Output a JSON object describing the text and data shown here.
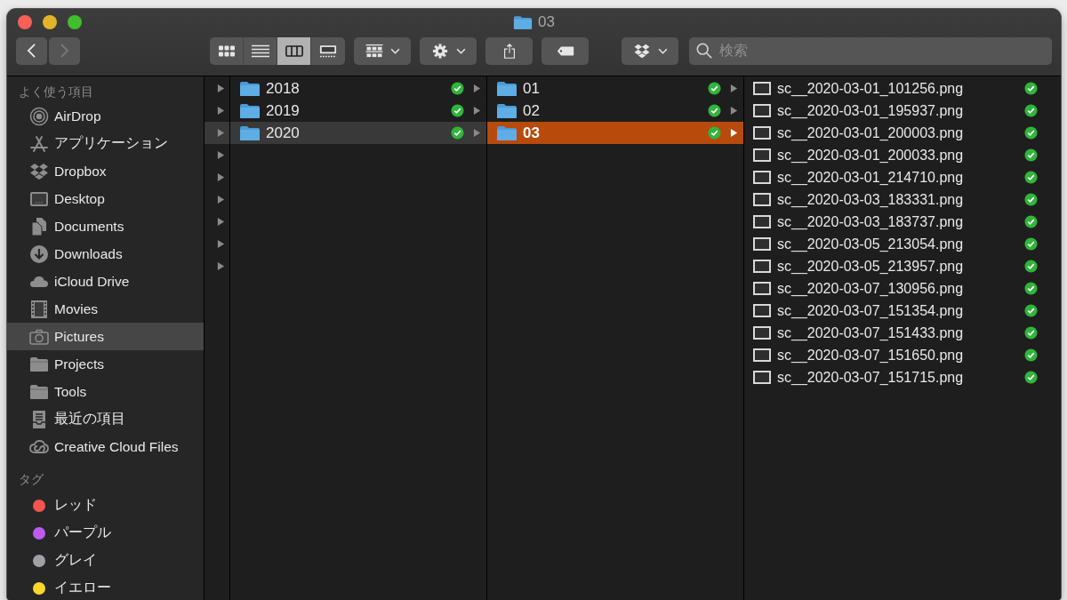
{
  "window": {
    "title": "03"
  },
  "toolbar": {
    "nav": [
      {
        "kind": "back",
        "disabled": false
      },
      {
        "kind": "forward",
        "disabled": true
      }
    ],
    "view_modes": [
      {
        "kind": "icons",
        "selected": false
      },
      {
        "kind": "list",
        "selected": false
      },
      {
        "kind": "columns",
        "selected": true
      },
      {
        "kind": "gallery",
        "selected": false
      }
    ],
    "buttons": [
      {
        "kind": "group",
        "menu": true
      },
      {
        "kind": "action",
        "menu": true
      },
      {
        "kind": "share",
        "menu": false
      },
      {
        "kind": "tag",
        "menu": false
      },
      {
        "kind": "dropbox",
        "menu": true
      }
    ],
    "search": {
      "placeholder": "検索"
    }
  },
  "sidebar": {
    "sections": [
      {
        "heading": "よく使う項目",
        "items": [
          {
            "kind": "airdrop",
            "label": "AirDrop",
            "selected": false
          },
          {
            "kind": "apps",
            "label": "アプリケーション",
            "selected": false
          },
          {
            "kind": "dropbox",
            "label": "Dropbox",
            "selected": false
          },
          {
            "kind": "desktop",
            "label": "Desktop",
            "selected": false
          },
          {
            "kind": "documents",
            "label": "Documents",
            "selected": false
          },
          {
            "kind": "downloads",
            "label": "Downloads",
            "selected": false
          },
          {
            "kind": "cloud",
            "label": "iCloud Drive",
            "selected": false
          },
          {
            "kind": "movies",
            "label": "Movies",
            "selected": false
          },
          {
            "kind": "pictures",
            "label": "Pictures",
            "selected": true
          },
          {
            "kind": "folder",
            "label": "Projects",
            "selected": false
          },
          {
            "kind": "folder",
            "label": "Tools",
            "selected": false
          },
          {
            "kind": "recent",
            "label": "最近の項目",
            "selected": false
          },
          {
            "kind": "creative-cloud",
            "label": "Creative Cloud Files",
            "selected": false
          }
        ]
      },
      {
        "heading": "タグ",
        "items": [
          {
            "kind": "tag",
            "label": "レッド",
            "color": "#f25450",
            "selected": false
          },
          {
            "kind": "tag",
            "label": "パープル",
            "color": "#be5af0",
            "selected": false
          },
          {
            "kind": "tag",
            "label": "グレイ",
            "color": "#a0a0a5",
            "selected": false
          },
          {
            "kind": "tag",
            "label": "イエロー",
            "color": "#fbd62c",
            "selected": false
          }
        ]
      }
    ]
  },
  "columns": [
    {
      "items": [
        {
          "kind": "stub",
          "selected": false,
          "focused": false
        },
        {
          "kind": "stub",
          "selected": false,
          "focused": false
        },
        {
          "kind": "stub",
          "selected": true,
          "focused": false
        },
        {
          "kind": "stub",
          "selected": false,
          "focused": false
        },
        {
          "kind": "stub",
          "selected": false,
          "focused": false
        },
        {
          "kind": "stub",
          "selected": false,
          "focused": false
        },
        {
          "kind": "stub",
          "selected": false,
          "focused": false
        },
        {
          "kind": "stub",
          "selected": false,
          "focused": false
        },
        {
          "kind": "stub",
          "selected": false,
          "focused": false
        }
      ]
    },
    {
      "items": [
        {
          "kind": "folder",
          "name": "2018",
          "synced": true,
          "selected": false,
          "focused": false
        },
        {
          "kind": "folder",
          "name": "2019",
          "synced": true,
          "selected": false,
          "focused": false
        },
        {
          "kind": "folder",
          "name": "2020",
          "synced": true,
          "selected": true,
          "focused": false
        }
      ]
    },
    {
      "items": [
        {
          "kind": "folder",
          "name": "01",
          "synced": true,
          "selected": false,
          "focused": false
        },
        {
          "kind": "folder",
          "name": "02",
          "synced": true,
          "selected": false,
          "focused": false
        },
        {
          "kind": "folder",
          "name": "03",
          "synced": true,
          "selected": true,
          "focused": true
        }
      ]
    },
    {
      "items": [
        {
          "kind": "file",
          "name": "sc__2020-03-01_101256.png",
          "synced": true,
          "selected": false
        },
        {
          "kind": "file",
          "name": "sc__2020-03-01_195937.png",
          "synced": true,
          "selected": false
        },
        {
          "kind": "file",
          "name": "sc__2020-03-01_200003.png",
          "synced": true,
          "selected": false
        },
        {
          "kind": "file",
          "name": "sc__2020-03-01_200033.png",
          "synced": true,
          "selected": false
        },
        {
          "kind": "file",
          "name": "sc__2020-03-01_214710.png",
          "synced": true,
          "selected": false
        },
        {
          "kind": "file",
          "name": "sc__2020-03-03_183331.png",
          "synced": true,
          "selected": false
        },
        {
          "kind": "file",
          "name": "sc__2020-03-03_183737.png",
          "synced": true,
          "selected": false
        },
        {
          "kind": "file",
          "name": "sc__2020-03-05_213054.png",
          "synced": true,
          "selected": false
        },
        {
          "kind": "file",
          "name": "sc__2020-03-05_213957.png",
          "synced": true,
          "selected": false
        },
        {
          "kind": "file",
          "name": "sc__2020-03-07_130956.png",
          "synced": true,
          "selected": false
        },
        {
          "kind": "file",
          "name": "sc__2020-03-07_151354.png",
          "synced": true,
          "selected": false
        },
        {
          "kind": "file",
          "name": "sc__2020-03-07_151433.png",
          "synced": true,
          "selected": false
        },
        {
          "kind": "file",
          "name": "sc__2020-03-07_151650.png",
          "synced": true,
          "selected": false
        },
        {
          "kind": "file",
          "name": "sc__2020-03-07_151715.png",
          "synced": true,
          "selected": false
        }
      ]
    }
  ]
}
